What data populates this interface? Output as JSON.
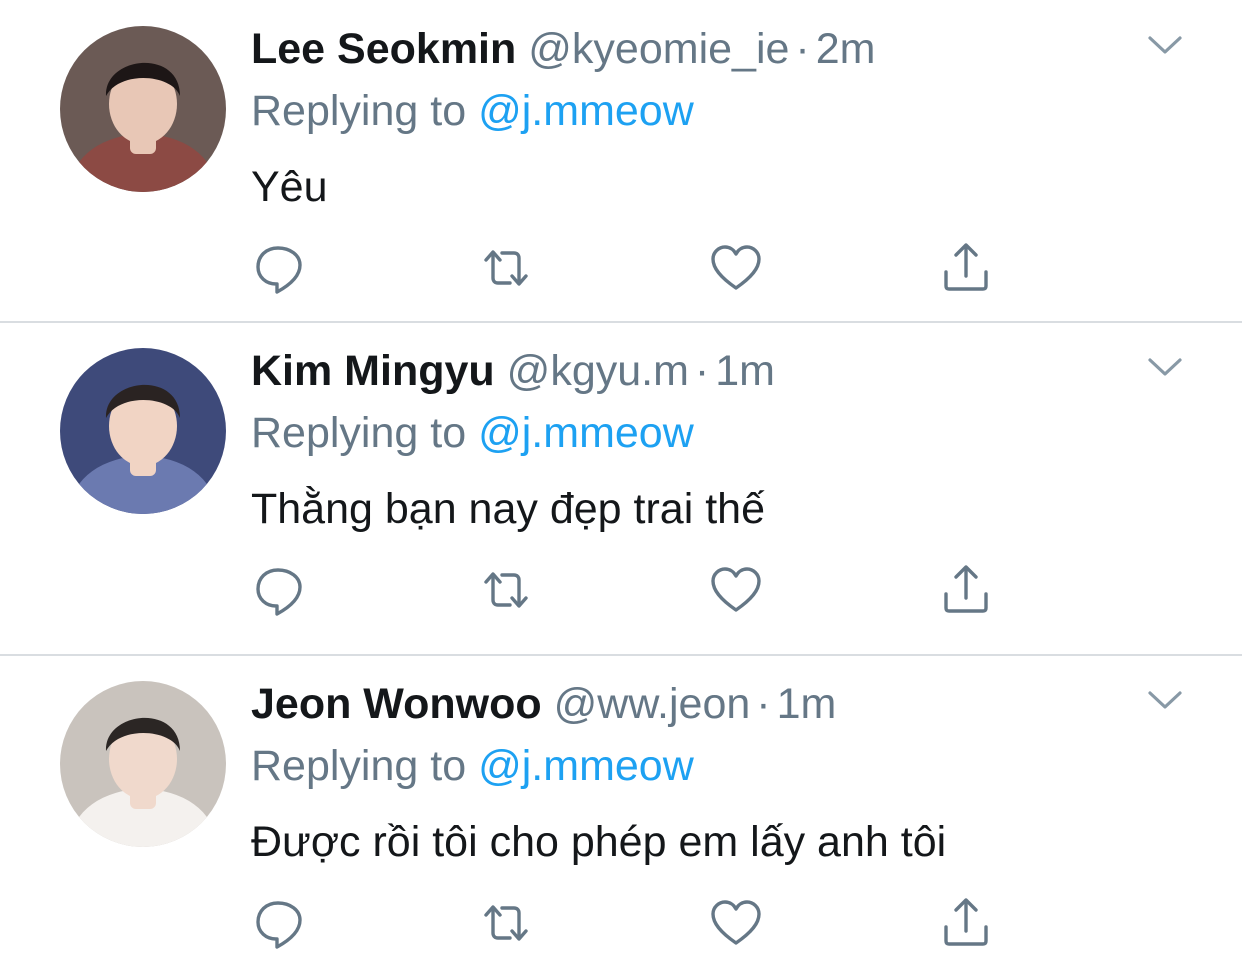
{
  "tweets": [
    {
      "name": "Lee Seokmin",
      "handle": "@kyeomie_ie",
      "separator": "·",
      "time": "2m",
      "replying_prefix": "Replying to",
      "replying_to": "@j.mmeow",
      "text": "Yêu",
      "avatar_colors": {
        "bg": "#6b5a55",
        "skin": "#e8c7b6",
        "hair": "#1d1616",
        "shirt": "#8c4a44"
      }
    },
    {
      "name": "Kim Mingyu",
      "handle": "@kgyu.m",
      "separator": "·",
      "time": "1m",
      "replying_prefix": "Replying to",
      "replying_to": "@j.mmeow",
      "text": "Thằng bạn nay đẹp trai thế",
      "avatar_colors": {
        "bg": "#3e4a7a",
        "skin": "#f1d4c4",
        "hair": "#2a2322",
        "shirt": "#6b7ab0"
      }
    },
    {
      "name": "Jeon Wonwoo",
      "handle": "@ww.jeon",
      "separator": "·",
      "time": "1m",
      "replying_prefix": "Replying to",
      "replying_to": "@j.mmeow",
      "text": "Được rồi tôi cho phép em lấy anh tôi",
      "avatar_colors": {
        "bg": "#c9c3bd",
        "skin": "#f0d9cc",
        "hair": "#2b2624",
        "shirt": "#f4f1ee"
      }
    }
  ],
  "icons": {
    "caret": "chevron-down-icon",
    "reply": "reply-icon",
    "retweet": "retweet-icon",
    "like": "heart-icon",
    "share": "share-icon"
  },
  "colors": {
    "name": "#14171a",
    "secondary": "#657786",
    "mention": "#1da1f2",
    "divider": "#d9dde1",
    "icon": "#657786",
    "caret": "#8899a6"
  }
}
